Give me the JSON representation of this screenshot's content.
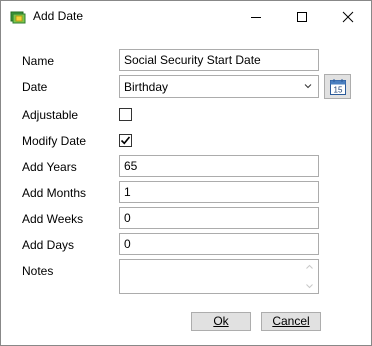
{
  "window": {
    "title": "Add Date",
    "icon": "calendar-money-icon"
  },
  "form": {
    "name": {
      "label": "Name",
      "value": "Social Security Start Date"
    },
    "date": {
      "label": "Date",
      "value": "Birthday"
    },
    "adjustable": {
      "label": "Adjustable",
      "checked": false
    },
    "modify_date": {
      "label": "Modify Date",
      "checked": true
    },
    "add_years": {
      "label": "Add Years",
      "value": "65"
    },
    "add_months": {
      "label": "Add Months",
      "value": "1"
    },
    "add_weeks": {
      "label": "Add Weeks",
      "value": "0"
    },
    "add_days": {
      "label": "Add Days",
      "value": "0"
    },
    "notes": {
      "label": "Notes",
      "value": ""
    }
  },
  "calendar_button": {
    "icon": "calendar-icon",
    "day": "15"
  },
  "buttons": {
    "ok": "Ok",
    "cancel": "Cancel"
  }
}
